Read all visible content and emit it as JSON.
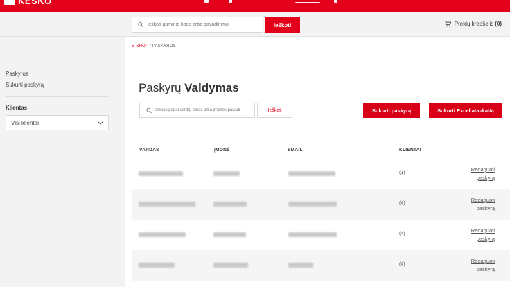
{
  "brand": {
    "name": "KESKO",
    "color": "#e2001a"
  },
  "header": {
    "search_placeholder": "Ieškoti gaminio kodo arba pavadinimo",
    "search_button": "Ieškoti",
    "cart_label": "Prekių krepšelis",
    "cart_count": "(0)"
  },
  "sidebar": {
    "links": [
      "Paskyros",
      "Sukurti paskyrą"
    ],
    "client_label": "Klientas",
    "client_select": "Visi klientai"
  },
  "breadcrumb": {
    "root": "E-SHOP",
    "separator": "/",
    "current": "PASKYROS"
  },
  "page": {
    "title_light": "Paskyrų",
    "title_bold": "Valdymas"
  },
  "filter": {
    "placeholder": "Ieškoti pagal vardą, email arba įmonės pavadi",
    "button": "Ieškoti"
  },
  "actions": {
    "create_account": "Sukurti paskyrą",
    "create_excel": "Sukurti Excel ataskaitą"
  },
  "table": {
    "headers": [
      "VARDAS",
      "ĮMONĖ",
      "EMAIL",
      "KLIENTAI"
    ],
    "rows": [
      {
        "clients": "(1)",
        "edit": "Redaguoti paskyrą"
      },
      {
        "clients": "(4)",
        "edit": "Redaguoti paskyrą"
      },
      {
        "clients": "(4)",
        "edit": "Redaguoti paskyrą"
      },
      {
        "clients": "(4)",
        "edit": "Redaguoti paskyrą"
      }
    ]
  }
}
